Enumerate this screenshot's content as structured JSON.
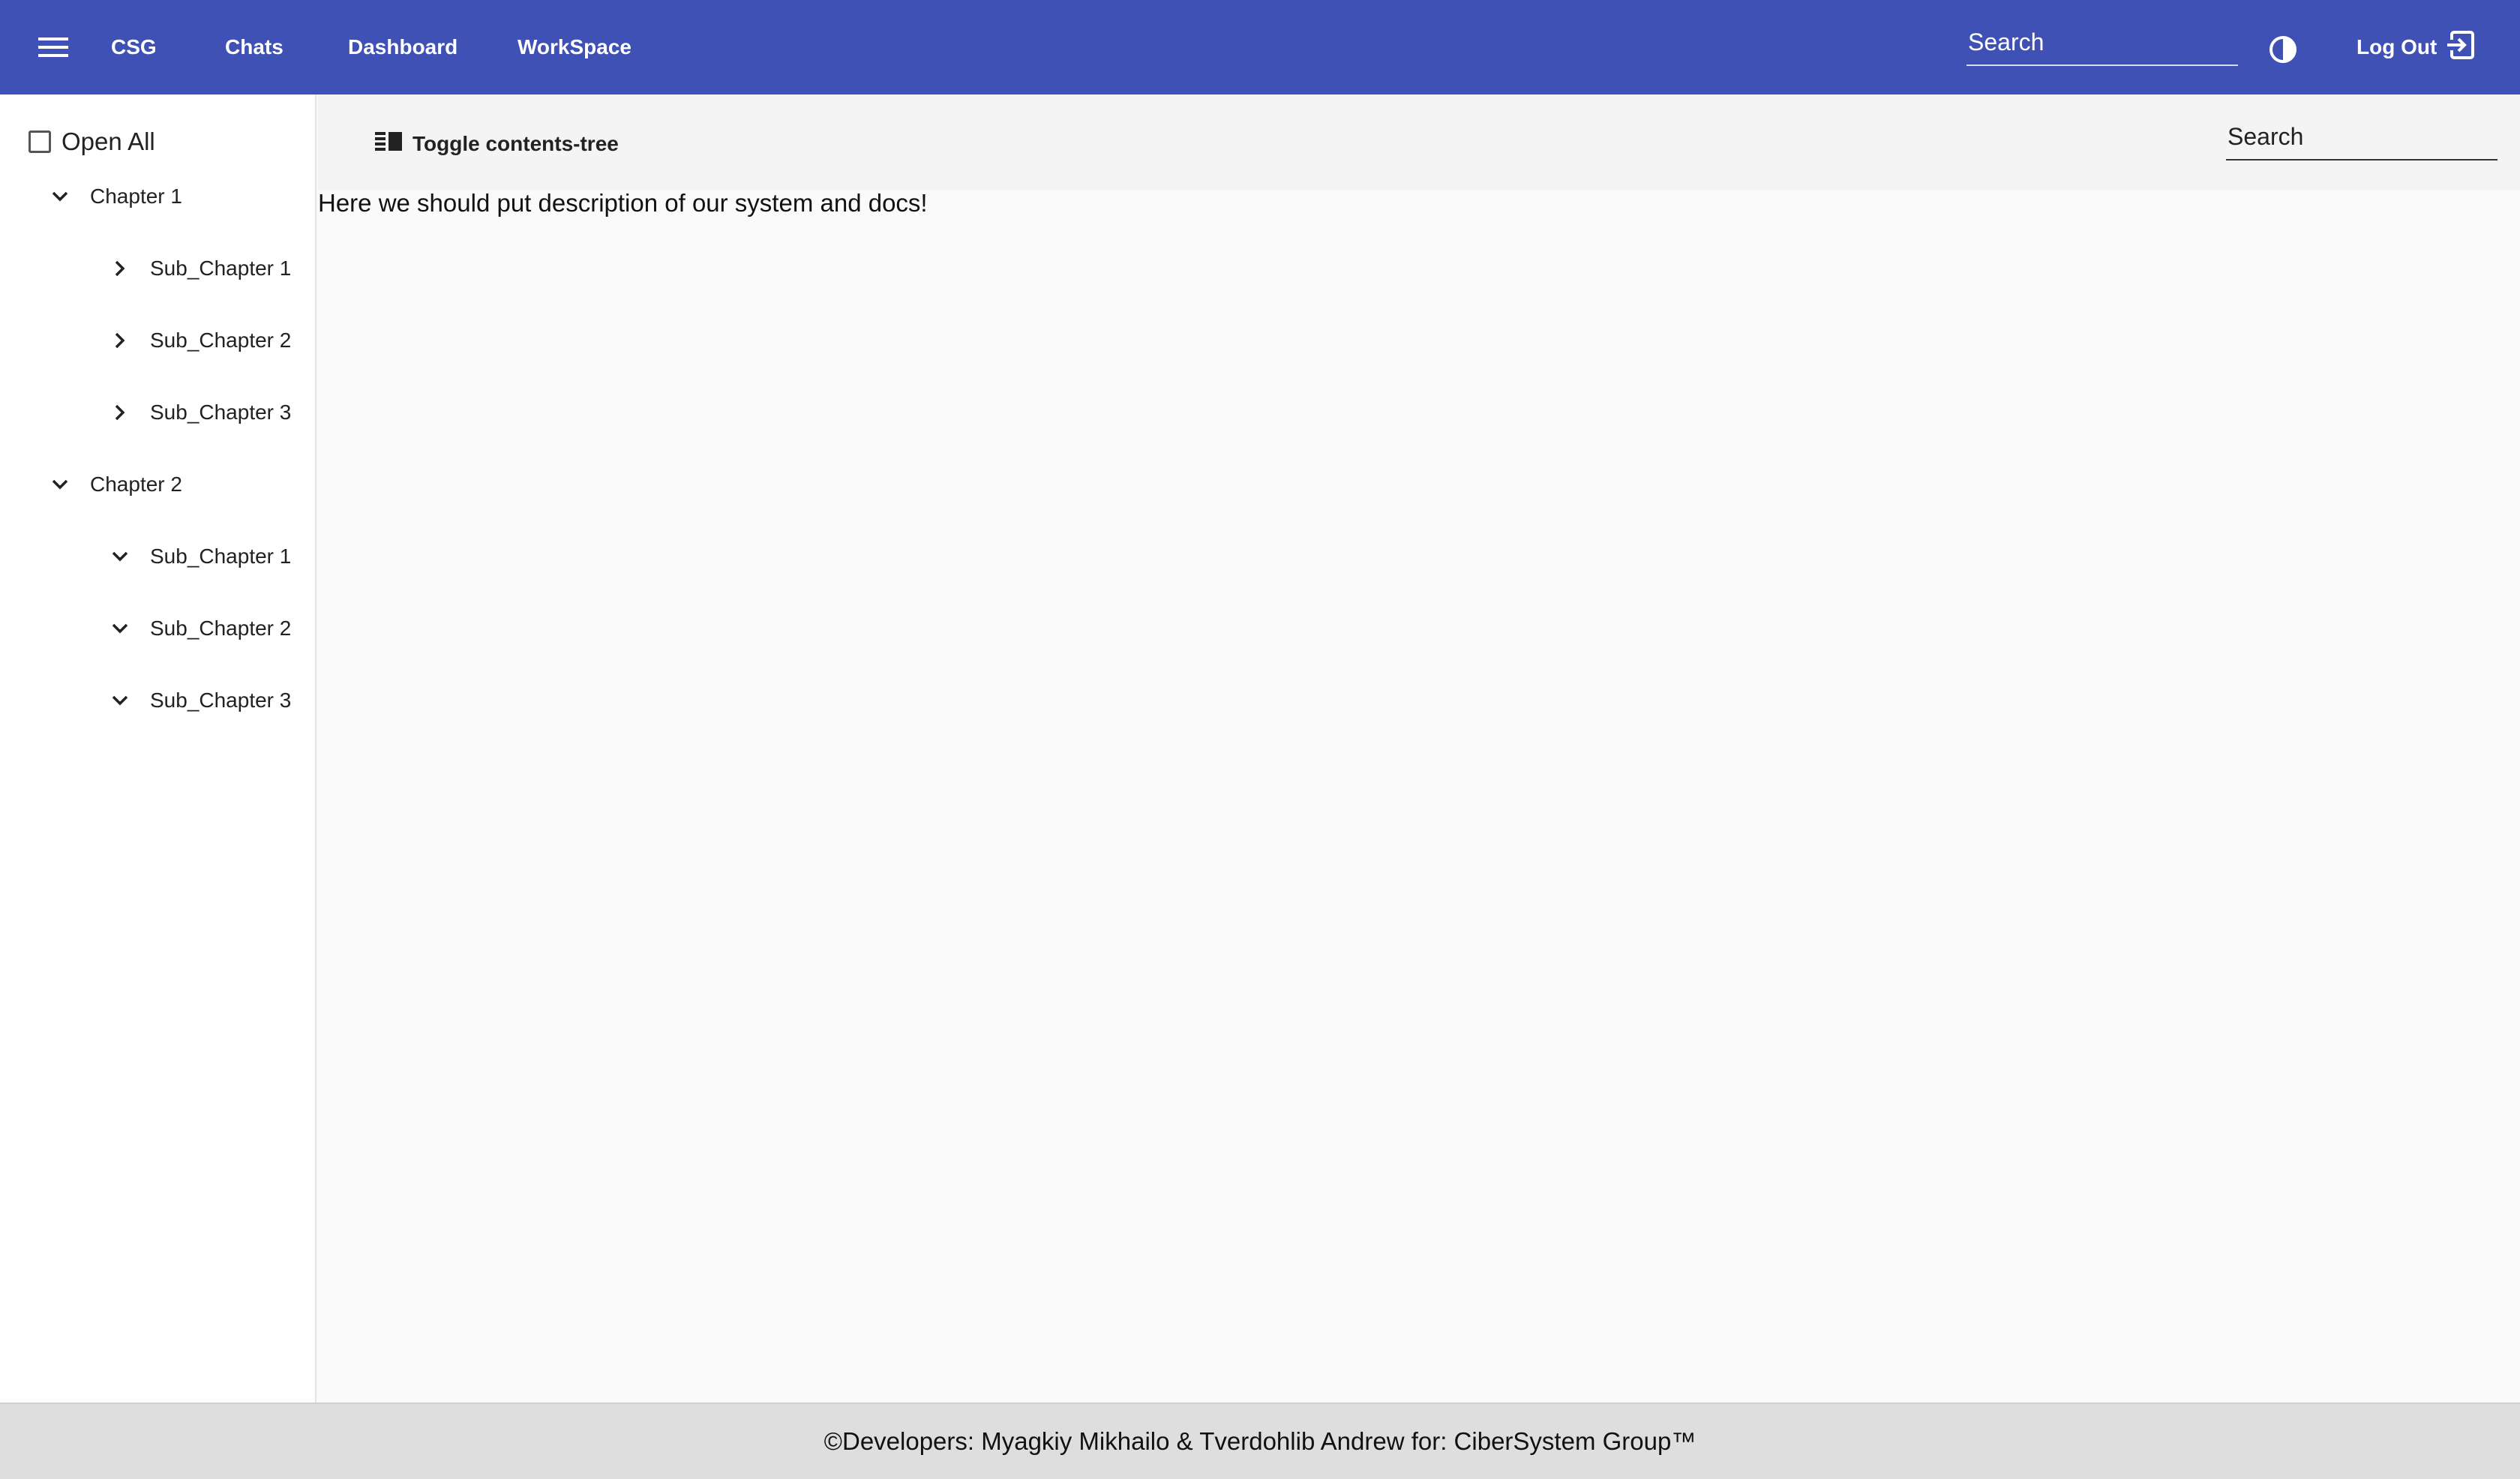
{
  "header": {
    "menu_icon": "hamburger-menu-icon",
    "nav": [
      {
        "label": "CSG"
      },
      {
        "label": "Chats"
      },
      {
        "label": "Dashboard"
      },
      {
        "label": "WorkSpace"
      }
    ],
    "search": {
      "placeholder": "Search",
      "value": ""
    },
    "theme_icon": "contrast-icon",
    "logout": {
      "label": "Log Out",
      "icon": "logout-icon"
    },
    "colors": {
      "background": "#3f51b5",
      "text": "#ffffff"
    }
  },
  "sidebar": {
    "open_all": {
      "label": "Open All",
      "checked": false
    },
    "tree": [
      {
        "label": "Chapter 1",
        "expanded": true,
        "children": [
          {
            "label": "Sub_Chapter 1",
            "expanded": false
          },
          {
            "label": "Sub_Chapter 2",
            "expanded": false
          },
          {
            "label": "Sub_Chapter 3",
            "expanded": false
          }
        ]
      },
      {
        "label": "Chapter 2",
        "expanded": true,
        "children": [
          {
            "label": "Sub_Chapter 1",
            "expanded": true
          },
          {
            "label": "Sub_Chapter 2",
            "expanded": true
          },
          {
            "label": "Sub_Chapter 3",
            "expanded": true
          }
        ]
      }
    ]
  },
  "content": {
    "toggle_button": {
      "label": "Toggle contents-tree",
      "icon": "toc-icon"
    },
    "search": {
      "placeholder": "Search",
      "value": ""
    },
    "description": "Here we should put description of our system and docs!"
  },
  "footer": {
    "text": "©Developers: Myagkiy Mikhailo & Tverdohlib Andrew for: CiberSystem Group™"
  }
}
